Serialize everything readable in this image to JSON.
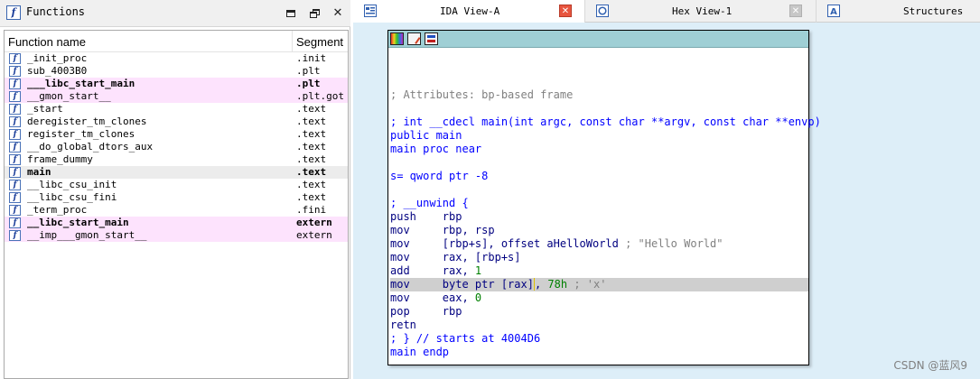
{
  "functions_pane": {
    "title": "Functions",
    "columns": {
      "name": "Function name",
      "segment": "Segment"
    },
    "rows": [
      {
        "name": "_init_proc",
        "segment": ".init",
        "style": "normal"
      },
      {
        "name": "sub_4003B0",
        "segment": ".plt",
        "style": "normal"
      },
      {
        "name": "___libc_start_main",
        "segment": ".plt",
        "style": "lib-bold"
      },
      {
        "name": "__gmon_start__",
        "segment": ".plt.got",
        "style": "lib"
      },
      {
        "name": "_start",
        "segment": ".text",
        "style": "normal"
      },
      {
        "name": "deregister_tm_clones",
        "segment": ".text",
        "style": "normal"
      },
      {
        "name": "register_tm_clones",
        "segment": ".text",
        "style": "normal"
      },
      {
        "name": "__do_global_dtors_aux",
        "segment": ".text",
        "style": "normal"
      },
      {
        "name": "frame_dummy",
        "segment": ".text",
        "style": "normal"
      },
      {
        "name": "main",
        "segment": ".text",
        "style": "selected-bold"
      },
      {
        "name": "__libc_csu_init",
        "segment": ".text",
        "style": "normal"
      },
      {
        "name": "__libc_csu_fini",
        "segment": ".text",
        "style": "normal"
      },
      {
        "name": "_term_proc",
        "segment": ".fini",
        "style": "normal"
      },
      {
        "name": "__libc_start_main",
        "segment": "extern",
        "style": "lib-bold"
      },
      {
        "name": "__imp___gmon_start__",
        "segment": "extern",
        "style": "lib"
      }
    ]
  },
  "tabs": [
    {
      "label": "IDA View-A",
      "icon": "ida-view-icon",
      "active": true
    },
    {
      "label": "Hex View-1",
      "icon": "hex-view-icon",
      "active": false
    },
    {
      "label": "Structures",
      "icon": "structures-icon",
      "active": false
    }
  ],
  "code_lines": [
    {
      "parts": []
    },
    {
      "parts": [
        {
          "t": "; Attributes: bp-based frame",
          "c": "cmt"
        }
      ]
    },
    {
      "parts": []
    },
    {
      "parts": [
        {
          "t": "; int __cdecl main(int argc, const char **argv, const char **envp)",
          "c": "kw"
        }
      ]
    },
    {
      "parts": [
        {
          "t": "public main",
          "c": "kw"
        }
      ]
    },
    {
      "parts": [
        {
          "t": "main proc near",
          "c": "kw"
        }
      ]
    },
    {
      "parts": []
    },
    {
      "parts": [
        {
          "t": "s= qword ptr -8",
          "c": "kw"
        }
      ]
    },
    {
      "parts": []
    },
    {
      "parts": [
        {
          "t": "; __unwind {",
          "c": "kw"
        }
      ]
    },
    {
      "parts": [
        {
          "t": "push    ",
          "c": "blk"
        },
        {
          "t": "rbp",
          "c": "blk"
        }
      ]
    },
    {
      "parts": [
        {
          "t": "mov     ",
          "c": "blk"
        },
        {
          "t": "rbp, rsp",
          "c": "blk"
        }
      ]
    },
    {
      "parts": [
        {
          "t": "mov     ",
          "c": "blk"
        },
        {
          "t": "[rbp+s], offset aHelloWorld",
          "c": "blk"
        },
        {
          "t": " ; \"Hello World\"",
          "c": "str"
        }
      ]
    },
    {
      "parts": [
        {
          "t": "mov     ",
          "c": "blk"
        },
        {
          "t": "rax, [rbp+s]",
          "c": "blk"
        }
      ]
    },
    {
      "parts": [
        {
          "t": "add     ",
          "c": "blk"
        },
        {
          "t": "rax, ",
          "c": "blk"
        },
        {
          "t": "1",
          "c": "num"
        }
      ]
    },
    {
      "parts": [
        {
          "t": "mov     ",
          "c": "blk"
        },
        {
          "t": "byte ptr ",
          "c": "blk"
        },
        {
          "t": "[rax]",
          "c": "blk"
        },
        {
          "t": ", ",
          "c": "blk"
        },
        {
          "t": "78h",
          "c": "num"
        },
        {
          "t": " ; 'x'",
          "c": "str"
        }
      ],
      "highlight": true
    },
    {
      "parts": [
        {
          "t": "mov     ",
          "c": "blk"
        },
        {
          "t": "eax, ",
          "c": "blk"
        },
        {
          "t": "0",
          "c": "num"
        }
      ]
    },
    {
      "parts": [
        {
          "t": "pop     ",
          "c": "blk"
        },
        {
          "t": "rbp",
          "c": "blk"
        }
      ]
    },
    {
      "parts": [
        {
          "t": "retn",
          "c": "blk"
        }
      ]
    },
    {
      "parts": [
        {
          "t": "; } // starts at 4004D6",
          "c": "kw"
        }
      ]
    },
    {
      "parts": [
        {
          "t": "main endp",
          "c": "kw"
        }
      ]
    }
  ],
  "watermark": "CSDN @蓝风9",
  "colors": {
    "library_row": "#fde3fd",
    "selected_row": "#ececec",
    "node_header": "#9fcfd5",
    "background": "#ddeef8",
    "highlight_line": "#cfcfcf"
  }
}
